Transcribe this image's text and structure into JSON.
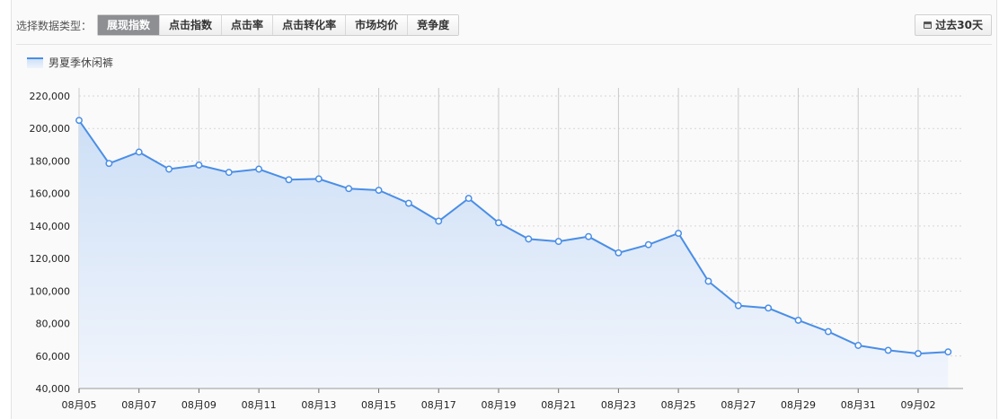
{
  "toolbar": {
    "label": "选择数据类型：",
    "tabs": [
      {
        "label": "展现指数",
        "active": true
      },
      {
        "label": "点击指数",
        "active": false
      },
      {
        "label": "点击率",
        "active": false
      },
      {
        "label": "点击转化率",
        "active": false
      },
      {
        "label": "市场均价",
        "active": false
      },
      {
        "label": "竞争度",
        "active": false
      }
    ],
    "range_button": "过去30天",
    "range_icon": "calendar-icon"
  },
  "colors": {
    "line": "#4a8ee6",
    "area_top": "#cddff6",
    "area_bottom": "#f1f5fc",
    "active_tab": "#8d8f93"
  },
  "chart_data": {
    "type": "area",
    "title": "",
    "xlabel": "",
    "ylabel": "",
    "legend_position": "top-left",
    "grid": true,
    "ylim": [
      40000,
      220000
    ],
    "y_ticks": [
      "40,000",
      "60,000",
      "80,000",
      "100,000",
      "120,000",
      "140,000",
      "160,000",
      "180,000",
      "200,000",
      "220,000"
    ],
    "x_tick_labels": [
      "08月05",
      "08月07",
      "08月09",
      "08月11",
      "08月13",
      "08月15",
      "08月17",
      "08月19",
      "08月21",
      "08月23",
      "08月25",
      "08月27",
      "08月29",
      "08月31",
      "09月02"
    ],
    "x": [
      "08-05",
      "08-06",
      "08-07",
      "08-08",
      "08-09",
      "08-10",
      "08-11",
      "08-12",
      "08-13",
      "08-14",
      "08-15",
      "08-16",
      "08-17",
      "08-18",
      "08-19",
      "08-20",
      "08-21",
      "08-22",
      "08-23",
      "08-24",
      "08-25",
      "08-26",
      "08-27",
      "08-28",
      "08-29",
      "08-30",
      "08-31",
      "09-01",
      "09-02",
      "09-03"
    ],
    "series": [
      {
        "name": "男夏季休闲裤",
        "values": [
          205000,
          178500,
          185500,
          175000,
          177500,
          173000,
          175000,
          168500,
          169000,
          163000,
          162000,
          154000,
          143000,
          157000,
          142000,
          132000,
          130500,
          133500,
          123500,
          128500,
          135500,
          106000,
          91000,
          89500,
          82000,
          75000,
          66500,
          63500,
          61500,
          62500
        ]
      }
    ]
  }
}
